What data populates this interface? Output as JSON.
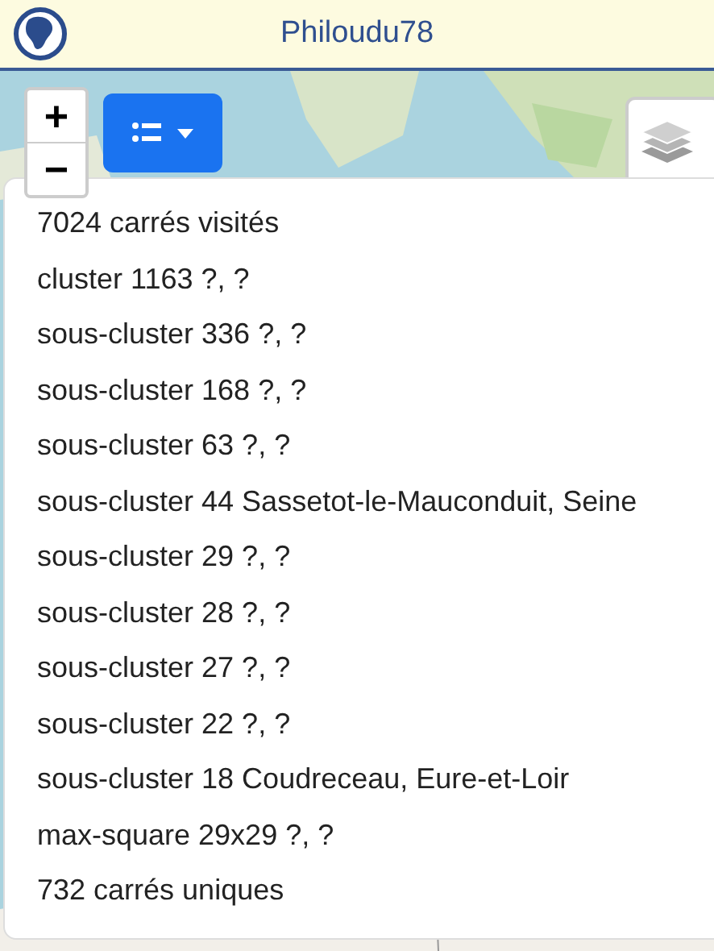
{
  "header": {
    "title": "Philoudu78"
  },
  "zoom": {
    "in": "+",
    "out": "−"
  },
  "menu": {
    "items": [
      "7024 carrés visités",
      "cluster 1163 ?, ?",
      "sous-cluster 336 ?, ?",
      "sous-cluster 168 ?, ?",
      "sous-cluster 63 ?, ?",
      "sous-cluster 44 Sassetot-le-Mauconduit, Seine",
      "sous-cluster 29 ?, ?",
      "sous-cluster 28 ?, ?",
      "sous-cluster 27 ?, ?",
      "sous-cluster 22 ?, ?",
      "sous-cluster 18 Coudreceau, Eure-et-Loir",
      "max-square 29x29 ?, ?",
      "732 carrés uniques"
    ]
  }
}
